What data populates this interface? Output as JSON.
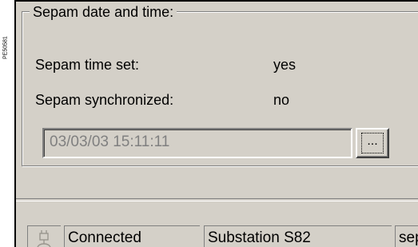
{
  "side_reference": "PE50581",
  "group": {
    "title": "Sepam date and time:",
    "rows": [
      {
        "label": "Sepam time set:",
        "value": "yes"
      },
      {
        "label": "Sepam synchronized:",
        "value": "no"
      }
    ],
    "date_value": "03/03/03 15:11:11",
    "browse_label": "..."
  },
  "status_bar": {
    "icon": "connection-plug-icon",
    "connection": "Connected",
    "substation": "Substation S82",
    "third": "sep"
  },
  "colors": {
    "face": "#d4d0c8",
    "shadow": "#808080",
    "disabled_text": "#808080"
  }
}
